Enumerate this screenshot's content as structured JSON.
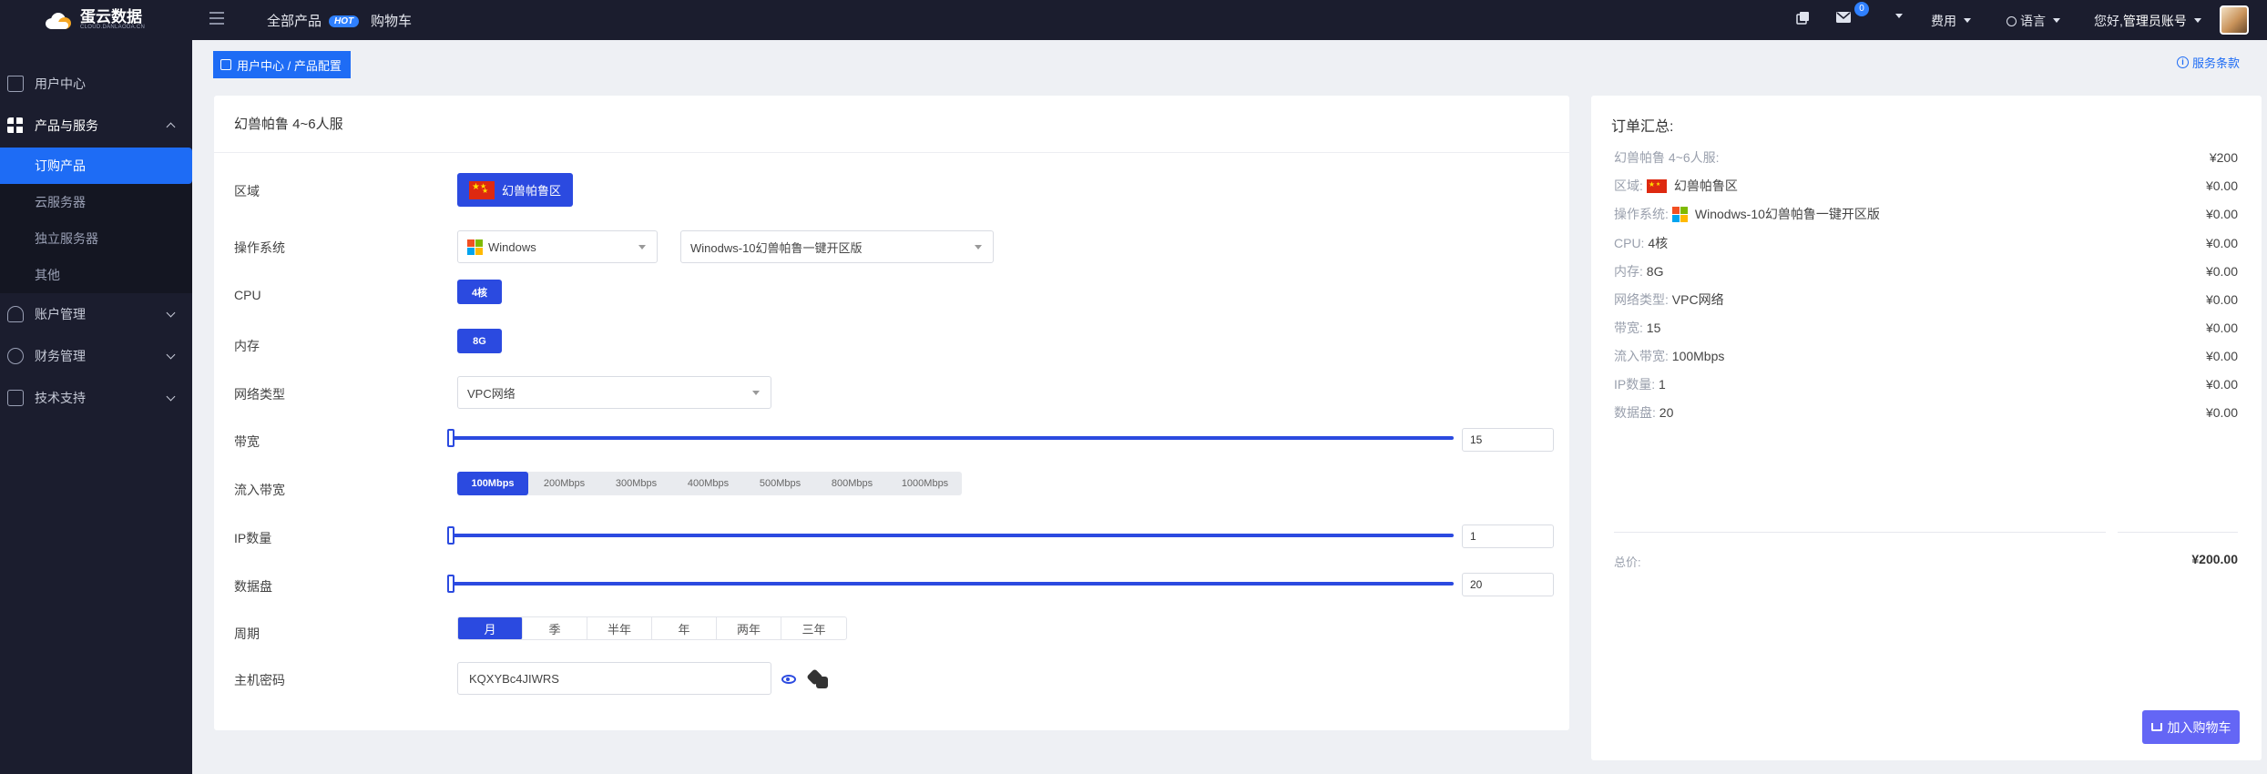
{
  "topbar": {
    "logo_main": "蛋云数据",
    "logo_sub": "CLOUD.DANLAODA.CN",
    "nav_products": "全部产品",
    "hot_badge": "HOT",
    "nav_cart": "购物车",
    "message_count": "0",
    "fees": "费用",
    "language": "语言",
    "greeting": "您好,",
    "account": "管理员账号"
  },
  "sidebar": {
    "items": [
      {
        "label": "用户中心"
      },
      {
        "label": "产品与服务"
      },
      {
        "label": "账户管理"
      },
      {
        "label": "财务管理"
      },
      {
        "label": "技术支持"
      }
    ],
    "sub_items": [
      {
        "label": "订购产品"
      },
      {
        "label": "云服务器"
      },
      {
        "label": "独立服务器"
      },
      {
        "label": "其他"
      }
    ]
  },
  "breadcrumb": "用户中心 / 产品配置",
  "terms_link": "服务条款",
  "config": {
    "title": "幻兽帕鲁 4~6人服",
    "labels": {
      "region": "区域",
      "os": "操作系统",
      "cpu": "CPU",
      "memory": "内存",
      "network": "网络类型",
      "bandwidth": "带宽",
      "inbound": "流入带宽",
      "ip": "IP数量",
      "disk": "数据盘",
      "cycle": "周期",
      "password": "主机密码"
    },
    "region_value": "幻兽帕鲁区",
    "os_family": "Windows",
    "os_image": "Winodws-10幻兽帕鲁一键开区版",
    "cpu_value": "4核",
    "memory_value": "8G",
    "network_value": "VPC网络",
    "bandwidth_value": "15",
    "bandwidth_fraction": 0.0,
    "inbound_options": [
      "100Mbps",
      "200Mbps",
      "300Mbps",
      "400Mbps",
      "500Mbps",
      "800Mbps",
      "1000Mbps"
    ],
    "ip_value": "1",
    "ip_fraction": 0.0,
    "disk_value": "20",
    "disk_fraction": 0.0,
    "cycle_options": [
      "月",
      "季",
      "半年",
      "年",
      "两年",
      "三年"
    ],
    "password_value": "KQXYBc4JIWRS"
  },
  "summary": {
    "title": "订单汇总:",
    "rows": [
      {
        "key": "幻兽帕鲁 4~6人服:",
        "value": "",
        "price": "¥200"
      },
      {
        "key": "区域:",
        "value": "幻兽帕鲁区",
        "price": "¥0.00"
      },
      {
        "key": "操作系统:",
        "value": "Winodws-10幻兽帕鲁一键开区版",
        "price": "¥0.00"
      },
      {
        "key": "CPU:",
        "value": "4核",
        "price": "¥0.00"
      },
      {
        "key": "内存:",
        "value": "8G",
        "price": "¥0.00"
      },
      {
        "key": "网络类型:",
        "value": "VPC网络",
        "price": "¥0.00"
      },
      {
        "key": "带宽:",
        "value": "15",
        "price": "¥0.00"
      },
      {
        "key": "流入带宽:",
        "value": "100Mbps",
        "price": "¥0.00"
      },
      {
        "key": "IP数量:",
        "value": "1",
        "price": "¥0.00"
      },
      {
        "key": "数据盘:",
        "value": "20",
        "price": "¥0.00"
      }
    ],
    "total_label": "总价:",
    "total_value": "¥200.00",
    "add_to_cart": "加入购物车"
  },
  "colors": {
    "primary": "#2b4ae0",
    "accent_blue": "#1e6cf5",
    "cart_button": "#6466f5",
    "dark": "#1b1d2e"
  }
}
